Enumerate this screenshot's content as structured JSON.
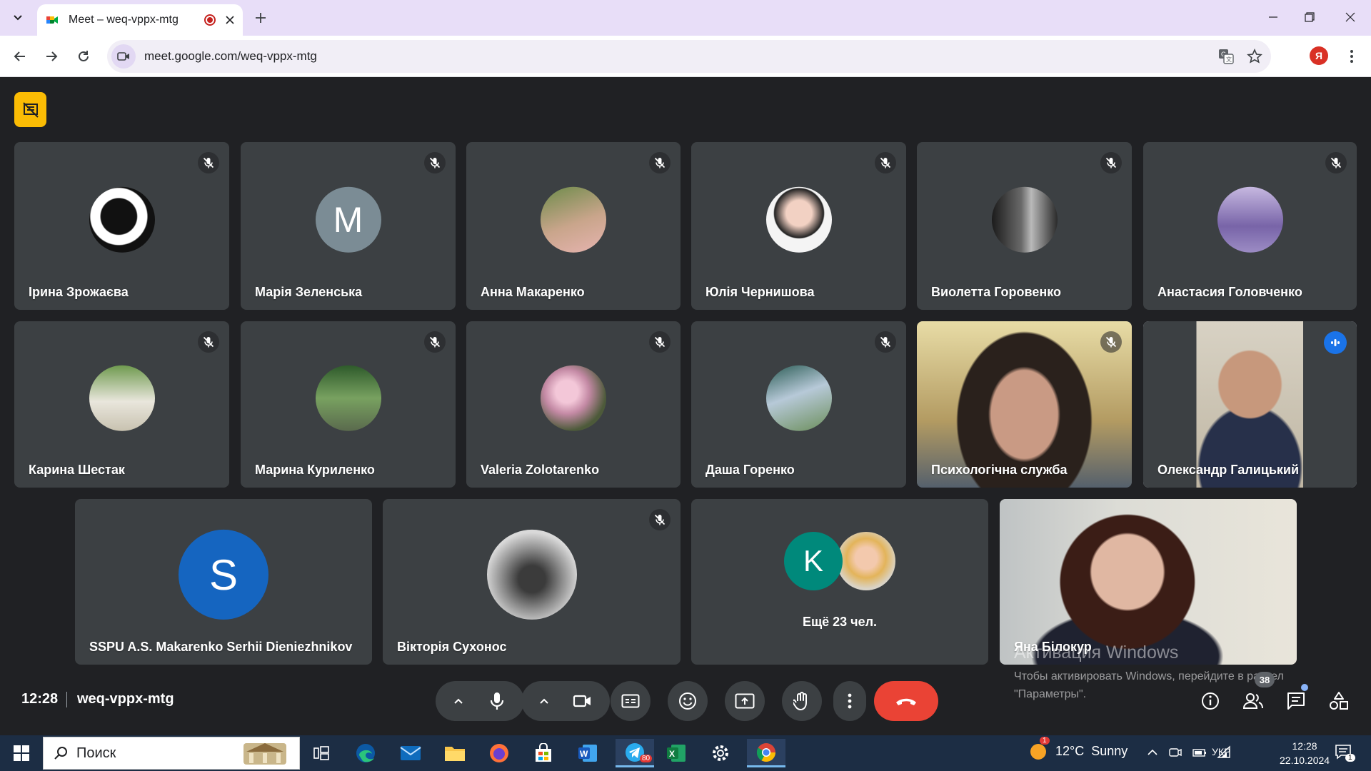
{
  "browser": {
    "tab_title": "Meet – weq-vppx-mtg",
    "url": "meet.google.com/weq-vppx-mtg",
    "profile_initial": "Я"
  },
  "tiles": [
    {
      "name": "Ірина Зрожаєва",
      "muted": true,
      "avatar": "photo"
    },
    {
      "name": "Марія Зеленська",
      "muted": true,
      "avatar": "letter",
      "letter": "M",
      "color": "#7b8c95"
    },
    {
      "name": "Анна Макаренко",
      "muted": true,
      "avatar": "photo"
    },
    {
      "name": "Юлія Чернишова",
      "muted": true,
      "avatar": "photo"
    },
    {
      "name": "Виолетта Горовенко",
      "muted": true,
      "avatar": "photo"
    },
    {
      "name": "Анастасия Головченко",
      "muted": true,
      "avatar": "photo"
    },
    {
      "name": "Карина Шестак",
      "muted": true,
      "avatar": "photo"
    },
    {
      "name": "Марина Куриленко",
      "muted": true,
      "avatar": "photo"
    },
    {
      "name": "Valeria Zolotarenko",
      "muted": true,
      "avatar": "photo"
    },
    {
      "name": "Даша Горенко",
      "muted": true,
      "avatar": "photo"
    },
    {
      "name": "Психологічна служба",
      "muted": true,
      "avatar": "video"
    },
    {
      "name": "Олександр Галицький",
      "muted": false,
      "speaking": true,
      "avatar": "video"
    },
    {
      "name": "SSPU A.S. Makarenko Serhii Dieniezhnikov",
      "muted": false,
      "avatar": "letter",
      "letter": "S",
      "color": "#1565c0"
    },
    {
      "name": "Вікторія Сухонос",
      "muted": true,
      "avatar": "photo"
    },
    {
      "name": "Ещё 23 чел.",
      "muted": false,
      "avatar": "overflow",
      "letter": "K",
      "color": "#00897b"
    },
    {
      "name": "Яна Білокур",
      "muted": false,
      "avatar": "video"
    }
  ],
  "meeting": {
    "time": "12:28",
    "code": "weq-vppx-mtg",
    "people_count": "38"
  },
  "watermark": {
    "title": "Активация Windows",
    "line1": "Чтобы активировать Windows, перейдите в раздел",
    "line2": "\"Параметры\"."
  },
  "taskbar": {
    "search_placeholder": "Поиск",
    "weather": "12°C  Sunny",
    "weather_badge": "1",
    "language": "УКР",
    "time": "12:28",
    "date": "22.10.2024",
    "telegram_badge": "80",
    "notification_badge": "1"
  },
  "colors": {
    "meet_bg": "#202124",
    "tile_bg": "#3c4043",
    "hangup": "#ea4335",
    "speaking_outline": "#8ab4f8",
    "titlebar": "#e8def8"
  }
}
